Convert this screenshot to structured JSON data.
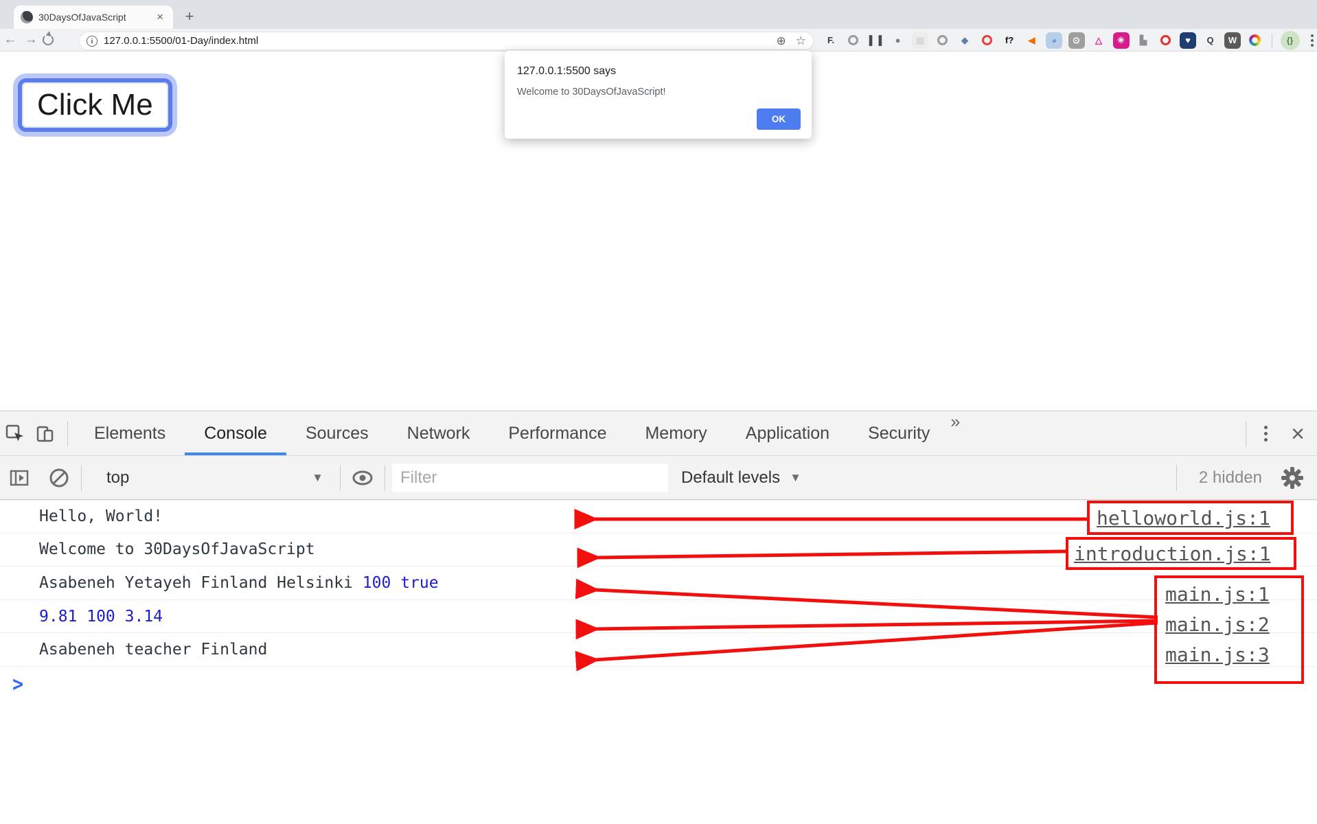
{
  "colors": {
    "annotation_red": "#f2100e",
    "devtools_accent": "#4285f4",
    "number_blue": "#1c1cd1",
    "link_gray": "#545454",
    "ok_button_blue": "#4d7bf0",
    "focus_ring_blue": "#5b7ce9",
    "focus_ring_halo": "#b9c8f8",
    "prompt_blue": "#3b6df2"
  },
  "browser": {
    "tab_title": "30DaysOfJavaScript",
    "url": "127.0.0.1:5500/01-Day/index.html",
    "extensions": [
      {
        "type": "text",
        "bg": "transparent",
        "fg": "#3a3a3a",
        "glyph": "F."
      },
      {
        "type": "ring",
        "fg": "#9a9a9a"
      },
      {
        "type": "text",
        "bg": "transparent",
        "fg": "#4a4a4a",
        "glyph": "▌▐"
      },
      {
        "type": "text",
        "bg": "transparent",
        "fg": "#7c7c7c",
        "glyph": "●"
      },
      {
        "type": "text",
        "bg": "#ececec",
        "fg": "#d8d8d8",
        "glyph": "▦"
      },
      {
        "type": "ring",
        "fg": "#9a9a9a"
      },
      {
        "type": "text",
        "bg": "transparent",
        "fg": "#5d84a6",
        "glyph": "◆"
      },
      {
        "type": "ring",
        "fg": "#e0413c"
      },
      {
        "type": "text",
        "bg": "transparent",
        "fg": "#111111",
        "glyph": "f?"
      },
      {
        "type": "text",
        "bg": "transparent",
        "fg": "#ef6c00",
        "glyph": "◀"
      },
      {
        "type": "circle",
        "bg": "#b8cfe9",
        "fg": "#6a97d8",
        "glyph": "◕"
      },
      {
        "type": "circle",
        "bg": "#9e9e9e",
        "fg": "#ffffff",
        "glyph": "⊙"
      },
      {
        "type": "text",
        "bg": "transparent",
        "fg": "#e91e8c",
        "glyph": "△"
      },
      {
        "type": "text",
        "bg": "#d81b8c",
        "fg": "#ffffff",
        "glyph": "✳"
      },
      {
        "type": "text",
        "bg": "transparent",
        "fg": "#8f8f8f",
        "glyph": "▙"
      },
      {
        "type": "ring",
        "fg": "#e2302e"
      },
      {
        "type": "circle",
        "bg": "#1d3f72",
        "fg": "#ffffff",
        "glyph": "♥"
      },
      {
        "type": "text",
        "bg": "transparent",
        "fg": "#3f3f3f",
        "glyph": "Q"
      },
      {
        "type": "circle",
        "bg": "#5a5a5a",
        "fg": "#ffffff",
        "glyph": "W"
      },
      {
        "type": "rainbow"
      }
    ]
  },
  "page": {
    "button_label": "Click Me"
  },
  "dialog": {
    "title": "127.0.0.1:5500 says",
    "message": "Welcome to 30DaysOfJavaScript!",
    "ok_label": "OK"
  },
  "devtools": {
    "tabs": [
      "Elements",
      "Console",
      "Sources",
      "Network",
      "Performance",
      "Memory",
      "Application",
      "Security",
      "»"
    ],
    "active_tab": "Console",
    "toolbar": {
      "context": "top",
      "filter_placeholder": "Filter",
      "levels_label": "Default levels",
      "hidden_badge": "2 hidden"
    },
    "console": {
      "prompt": ">",
      "rows": [
        {
          "segments": [
            {
              "text": "Hello, World!",
              "type": "string"
            }
          ],
          "link": "helloworld.js:1"
        },
        {
          "segments": [
            {
              "text": "Welcome to 30DaysOfJavaScript",
              "type": "string"
            }
          ],
          "link": "introduction.js:1"
        },
        {
          "segments": [
            {
              "text": "Asabeneh Yetayeh Finland Helsinki ",
              "type": "string"
            },
            {
              "text": "100",
              "type": "number"
            },
            {
              "text": " ",
              "type": "string"
            },
            {
              "text": "true",
              "type": "boolean"
            }
          ],
          "link": "main.js:1"
        },
        {
          "segments": [
            {
              "text": "9.81 100 3.14",
              "type": "number"
            }
          ],
          "link": "main.js:2"
        },
        {
          "segments": [
            {
              "text": "Asabeneh teacher Finland",
              "type": "string"
            }
          ],
          "link": "main.js:3"
        }
      ]
    }
  }
}
